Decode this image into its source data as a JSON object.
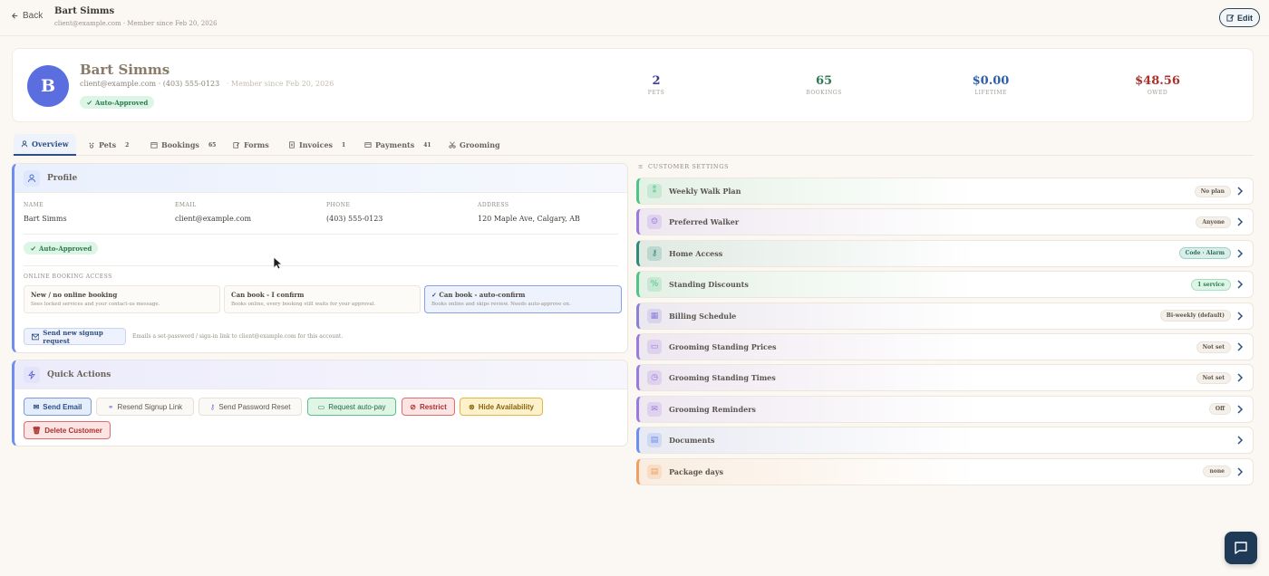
{
  "topbar": {
    "back_label": "Back",
    "name": "Bart Simms",
    "subtitle": "client@example.com · Member since Feb 20, 2026",
    "edit_label": "Edit"
  },
  "header": {
    "avatar_initial": "B",
    "name": "Bart Simms",
    "email": "client@example.com",
    "sep": "·",
    "phone": "(403) 555-0123",
    "member_since": "· Member since Feb 20, 2026",
    "badge": "Auto-Approved",
    "stats": [
      {
        "value": "2",
        "label": "PETS",
        "color": "#3a3e93"
      },
      {
        "value": "65",
        "label": "BOOKINGS",
        "color": "#2e7a55"
      },
      {
        "value": "$0.00",
        "label": "LIFETIME",
        "color": "#2d5fa8"
      },
      {
        "value": "$48.56",
        "label": "OWED",
        "color": "#a8332c"
      }
    ]
  },
  "tabs": [
    {
      "label": "Overview",
      "count": "",
      "icon": "person-icon"
    },
    {
      "label": "Pets",
      "count": "2",
      "icon": "paw-icon"
    },
    {
      "label": "Bookings",
      "count": "65",
      "icon": "calendar-icon"
    },
    {
      "label": "Forms",
      "count": "",
      "icon": "edit-icon"
    },
    {
      "label": "Invoices",
      "count": "1",
      "icon": "document-icon"
    },
    {
      "label": "Payments",
      "count": "41",
      "icon": "card-icon"
    },
    {
      "label": "Grooming",
      "count": "",
      "icon": "scissors-icon"
    }
  ],
  "profile": {
    "title": "Profile",
    "fields": [
      {
        "label": "NAME",
        "value": "Bart Simms"
      },
      {
        "label": "EMAIL",
        "value": "client@example.com"
      },
      {
        "label": "PHONE",
        "value": "(403) 555-0123"
      },
      {
        "label": "ADDRESS",
        "value": "120 Maple Ave, Calgary, AB"
      }
    ],
    "badge": "Auto-Approved",
    "access_title": "ONLINE BOOKING ACCESS",
    "options": [
      {
        "title": "New / no online booking",
        "desc": "Sees locked services and your contact-us message."
      },
      {
        "title": "Can book - I confirm",
        "desc": "Books online, every booking still waits for your approval."
      },
      {
        "title": "Can book - auto-confirm",
        "desc": "Books online and skips review. Needs auto-approve on."
      }
    ],
    "signup_button": "Send new signup request",
    "signup_note": "Emails a set-password / sign-in link to client@example.com for this account."
  },
  "quick_actions": {
    "title": "Quick Actions",
    "buttons": [
      {
        "label": "Send Email",
        "icon": "mail-icon"
      },
      {
        "label": "Resend Signup Link",
        "icon": "link-icon"
      },
      {
        "label": "Send Password Reset",
        "icon": "key-icon"
      },
      {
        "label": "Request auto-pay",
        "icon": "card-icon"
      },
      {
        "label": "Restrict",
        "icon": "ban-icon"
      },
      {
        "label": "Hide Availability",
        "icon": "eye-off-icon"
      },
      {
        "label": "Delete Customer",
        "icon": "trash-icon"
      }
    ]
  },
  "customer_settings": {
    "title": "CUSTOMER SETTINGS",
    "rows": [
      {
        "label": "Weekly Walk Plan",
        "pill": "No plan",
        "icon": "footprints-icon",
        "accent": "#4fc48a"
      },
      {
        "label": "Preferred Walker",
        "pill": "Anyone",
        "icon": "person-icon",
        "accent": "#9a7ae0"
      },
      {
        "label": "Home Access",
        "pill": "Code · Alarm",
        "icon": "key-icon",
        "accent": "#2f8a7a"
      },
      {
        "label": "Standing Discounts",
        "pill": "1 service",
        "icon": "percent-icon",
        "accent": "#4fc48a"
      },
      {
        "label": "Billing Schedule",
        "pill": "Bi-weekly (default)",
        "icon": "calendar-icon",
        "accent": "#8a80d8"
      },
      {
        "label": "Grooming Standing Prices",
        "pill": "Not set",
        "icon": "tag-icon",
        "accent": "#9a7ae0"
      },
      {
        "label": "Grooming Standing Times",
        "pill": "Not set",
        "icon": "clock-icon",
        "accent": "#9a7ae0"
      },
      {
        "label": "Grooming Reminders",
        "pill": "Off",
        "icon": "mail-icon",
        "accent": "#9a7ae0"
      },
      {
        "label": "Documents",
        "pill": "",
        "icon": "document-icon",
        "accent": "#6d8ef0"
      },
      {
        "label": "Package days",
        "pill": "none",
        "icon": "ticket-icon",
        "accent": "#f0a060"
      }
    ]
  }
}
